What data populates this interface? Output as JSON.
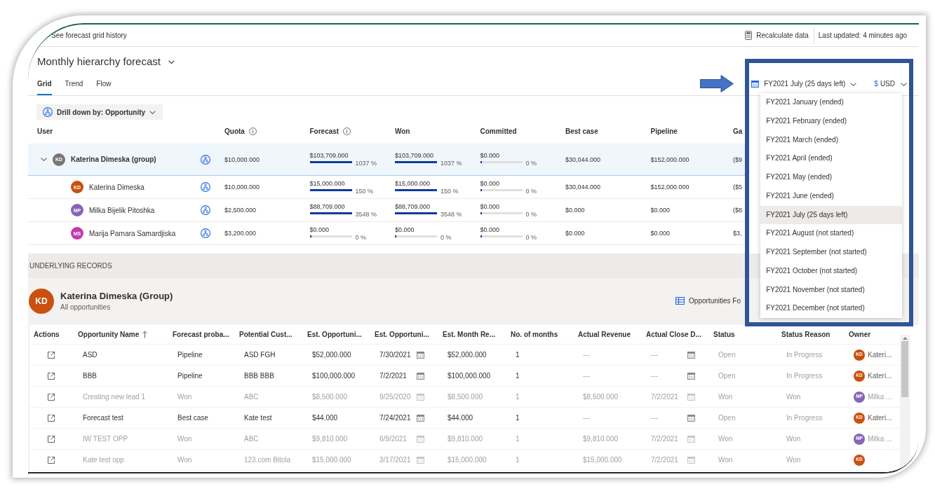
{
  "top_bar": {
    "history_link": "See forecast grid history",
    "recalculate": "Recalculate data",
    "last_updated": "Last updated: 4 minutes ago"
  },
  "forecast": {
    "title": "Monthly hierarchy forecast",
    "tabs": [
      {
        "label": "Grid",
        "selected": true
      },
      {
        "label": "Trend",
        "selected": false
      },
      {
        "label": "Flow",
        "selected": false
      }
    ]
  },
  "period_selector": {
    "value": "FY2021 July (25 days left)",
    "expanded": true,
    "options": [
      {
        "label": "FY2021 January (ended)",
        "selected": false
      },
      {
        "label": "FY2021 February (ended)",
        "selected": false
      },
      {
        "label": "FY2021 March (ended)",
        "selected": false
      },
      {
        "label": "FY2021 April (ended)",
        "selected": false
      },
      {
        "label": "FY2021 May (ended)",
        "selected": false
      },
      {
        "label": "FY2021 June (ended)",
        "selected": false
      },
      {
        "label": "FY2021 July (25 days left)",
        "selected": true
      },
      {
        "label": "FY2021 August (not started)",
        "selected": false
      },
      {
        "label": "FY2021 September (not started)",
        "selected": false
      },
      {
        "label": "FY2021 October (not started)",
        "selected": false
      },
      {
        "label": "FY2021 November (not started)",
        "selected": false
      },
      {
        "label": "FY2021 December (not started)",
        "selected": false
      }
    ]
  },
  "currency_selector": {
    "symbol": "$",
    "value": "USD"
  },
  "drill_down": {
    "label": "Drill down by: Opportunity"
  },
  "grid": {
    "columns": [
      {
        "label": "User",
        "kind": "user",
        "info": false
      },
      {
        "label": "Quota",
        "kind": "text",
        "info": true
      },
      {
        "label": "Forecast",
        "kind": "progress",
        "info": true
      },
      {
        "label": "Won",
        "kind": "progress",
        "info": false
      },
      {
        "label": "Committed",
        "kind": "progress",
        "info": false
      },
      {
        "label": "Best case",
        "kind": "text",
        "info": false
      },
      {
        "label": "Pipeline",
        "kind": "text",
        "info": false
      },
      {
        "label": "Ga",
        "kind": "text",
        "info": false
      }
    ],
    "rows": [
      {
        "selected": true,
        "expanded": true,
        "cells": [
          {
            "initials": "KD",
            "color": "#7a7574",
            "name": "Katerina Dimeska (group)"
          },
          {
            "text": "$10,000.000"
          },
          {
            "text": "$103,709.000",
            "level": 1,
            "percent": "1037 %"
          },
          {
            "text": "$103,709.000",
            "level": 1,
            "percent": "1037 %"
          },
          {
            "text": "$0.000",
            "level": 0,
            "percent": "0 %"
          },
          {
            "text": "$30,044.000"
          },
          {
            "text": "$152,000.000"
          },
          {
            "text": "($9"
          }
        ],
        "children": [
          {
            "selected": false,
            "cells": [
              {
                "initials": "KD",
                "color": "#ca5010",
                "name": "Katerina Dimeska"
              },
              {
                "text": "$10,000.000"
              },
              {
                "text": "$15,000.000",
                "level": 1,
                "percent": "150 %"
              },
              {
                "text": "$15,000.000",
                "level": 1,
                "percent": "150 %"
              },
              {
                "text": "$0.000",
                "level": 0,
                "percent": "0 %"
              },
              {
                "text": "$30,044.000"
              },
              {
                "text": "$152,000.000"
              },
              {
                "text": "($5"
              }
            ]
          },
          {
            "selected": false,
            "cells": [
              {
                "initials": "MP",
                "color": "#8764b8",
                "name": "Milka Bijelik Pitoshka"
              },
              {
                "text": "$2,500.000"
              },
              {
                "text": "$88,709.000",
                "level": 1,
                "percent": "3548 %"
              },
              {
                "text": "$88,709.000",
                "level": 1,
                "percent": "3548 %"
              },
              {
                "text": "$0.000",
                "level": 0,
                "percent": "0 %"
              },
              {
                "text": "$0.000"
              },
              {
                "text": "$0.000"
              },
              {
                "text": "($8"
              }
            ]
          },
          {
            "selected": false,
            "cells": [
              {
                "initials": "MS",
                "color": "#c239b3",
                "name": "Marija Parnara Samardjiska"
              },
              {
                "text": "$3,200.000"
              },
              {
                "text": "$0.000",
                "level": 0,
                "percent": "0 %"
              },
              {
                "text": "$0.000",
                "level": 0,
                "percent": "0 %"
              },
              {
                "text": "$0.000",
                "level": 0,
                "percent": "0 %"
              },
              {
                "text": "$0.000"
              },
              {
                "text": "$0.000"
              },
              {
                "text": "$3,"
              }
            ]
          }
        ]
      }
    ]
  },
  "underlying_records": {
    "heading": "UNDERLYING RECORDS",
    "owner": {
      "initials": "KD",
      "color": "#ca5010",
      "name": "Katerina Dimeska (Group)",
      "subtitle": "All opportunities"
    },
    "view_selector": "Opportunities Fo",
    "table": {
      "columns": [
        {
          "label": "Actions",
          "kind": "action",
          "sorted": false,
          "muted": false
        },
        {
          "label": "Opportunity Name",
          "kind": "text",
          "sorted": true,
          "muted": false
        },
        {
          "label": "Forecast proba...",
          "kind": "text",
          "sorted": false,
          "muted": false
        },
        {
          "label": "Potential Cust...",
          "kind": "text",
          "sorted": false,
          "muted": false
        },
        {
          "label": "Est. Opportuni...",
          "kind": "text",
          "sorted": false,
          "muted": false
        },
        {
          "label": "Est. Opportuni...",
          "kind": "date",
          "sorted": false,
          "muted": false
        },
        {
          "label": "Est. Month Re...",
          "kind": "text",
          "sorted": false,
          "muted": false
        },
        {
          "label": "No. of months",
          "kind": "text",
          "sorted": false,
          "muted": false
        },
        {
          "label": "Actual Revenue",
          "kind": "text",
          "sorted": false,
          "muted": true
        },
        {
          "label": "Actual Close D...",
          "kind": "date",
          "sorted": false,
          "muted": true
        },
        {
          "label": "Status",
          "kind": "text",
          "sorted": false,
          "muted": true
        },
        {
          "label": "Status Reason",
          "kind": "text",
          "sorted": false,
          "muted": true
        },
        {
          "label": "Owner",
          "kind": "owner",
          "sorted": false,
          "muted": false
        }
      ],
      "rows": [
        {
          "read_only": false,
          "cells": [
            "",
            "ASD",
            "Pipeline",
            "ASD FGH",
            "$52,000.000",
            "7/30/2021",
            "$52,000.000",
            "1",
            "---",
            "---",
            "Open",
            "In Progress",
            {
              "initials": "KD",
              "color": "#ca5010",
              "name": "Kateri..."
            }
          ]
        },
        {
          "read_only": false,
          "cells": [
            "",
            "BBB",
            "Pipeline",
            "BBB BBB",
            "$100,000.000",
            "7/2/2021",
            "$100,000.000",
            "1",
            "---",
            "---",
            "Open",
            "In Progress",
            {
              "initials": "KD",
              "color": "#ca5010",
              "name": "Kateri..."
            }
          ]
        },
        {
          "read_only": true,
          "cells": [
            "",
            "Creating new lead 1",
            "Won",
            "ABC",
            "$8,500.000",
            "9/25/2020",
            "$8,500.000",
            "1",
            "$8,500.000",
            "7/2/2021",
            "Won",
            "Won",
            {
              "initials": "MP",
              "color": "#8764b8",
              "name": "Milka ..."
            }
          ]
        },
        {
          "read_only": false,
          "cells": [
            "",
            "Forecast test",
            "Best case",
            "Kate test",
            "$44.000",
            "7/24/2021",
            "$44.000",
            "1",
            "---",
            "---",
            "Open",
            "In Progress",
            {
              "initials": "KD",
              "color": "#ca5010",
              "name": "Kateri..."
            }
          ]
        },
        {
          "read_only": true,
          "cells": [
            "",
            "IW TEST OPP",
            "Won",
            "ABC",
            "$9,810.000",
            "6/9/2021",
            "$9,810.000",
            "1",
            "$9,810.000",
            "7/2/2021",
            "Won",
            "Won",
            {
              "initials": "MP",
              "color": "#8764b8",
              "name": "Milka ..."
            }
          ]
        },
        {
          "read_only": true,
          "cells": [
            "",
            "Kate test opp",
            "Won",
            "123.com Bitola",
            "$15,000.000",
            "3/17/2021",
            "$15,000.000",
            "1",
            "$15,000.000",
            "7/2/2021",
            "Won",
            "Won",
            {
              "initials": "KD",
              "color": "#ca5010"
            }
          ]
        }
      ]
    }
  }
}
